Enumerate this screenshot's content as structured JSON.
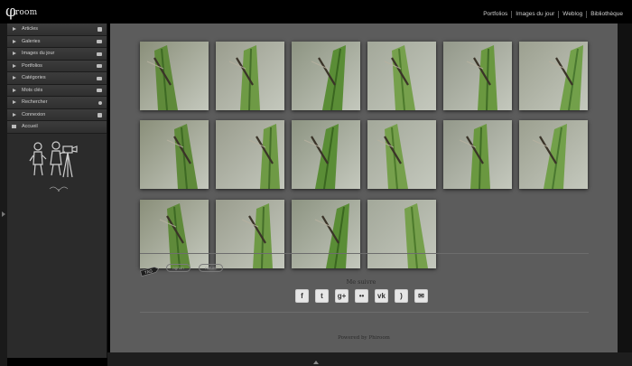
{
  "header": {
    "logo_text": "room",
    "nav": [
      "Portfolios",
      "Images du jour",
      "Weblog",
      "Bibliothèque"
    ]
  },
  "sidebar": {
    "items": [
      {
        "label": "Articles",
        "icon": "document-icon"
      },
      {
        "label": "Galeries",
        "icon": "gallery-icon"
      },
      {
        "label": "Images du jour",
        "icon": "gallery-icon"
      },
      {
        "label": "Portfolios",
        "icon": "gallery-icon"
      },
      {
        "label": "Catégories",
        "icon": "folder-icon"
      },
      {
        "label": "Mots clés",
        "icon": "tags-icon"
      },
      {
        "label": "Rechercher",
        "icon": "search-icon"
      },
      {
        "label": "Connexion",
        "icon": "login-icon"
      },
      {
        "label": "Accueil",
        "icon": "home-icon"
      }
    ]
  },
  "gallery": {
    "thumbnails": [
      {
        "subject": "damselfly on leaf"
      },
      {
        "subject": "damselfly on leaf"
      },
      {
        "subject": "damselfly on leaf"
      },
      {
        "subject": "damselfly on leaf"
      },
      {
        "subject": "damselfly on leaf"
      },
      {
        "subject": "damselfly on leaf"
      },
      {
        "subject": "damselfly on leaf"
      },
      {
        "subject": "damselfly on stem"
      },
      {
        "subject": "damselfly on stem"
      },
      {
        "subject": "dew on leaf"
      },
      {
        "subject": "damselfly on stem"
      },
      {
        "subject": "damselfly on stem"
      },
      {
        "subject": "damselfly on stem"
      },
      {
        "subject": "damselfly on stem"
      },
      {
        "subject": "damselfly on stem"
      },
      {
        "subject": "grass blades"
      }
    ]
  },
  "tags": {
    "icon_label": "TAG",
    "items": [
      "agrion",
      "nature"
    ]
  },
  "social": {
    "title": "Me suivre",
    "networks": [
      {
        "name": "facebook-icon",
        "glyph": "f"
      },
      {
        "name": "twitter-icon",
        "glyph": "t"
      },
      {
        "name": "google-plus-icon",
        "glyph": "g+"
      },
      {
        "name": "flickr-icon",
        "glyph": "••"
      },
      {
        "name": "vk-icon",
        "glyph": "vk"
      },
      {
        "name": "rss-icon",
        "glyph": ")"
      },
      {
        "name": "email-icon",
        "glyph": "✉"
      }
    ]
  },
  "footer": {
    "powered_by": "Powered by Phiroom"
  },
  "colors": {
    "background": "#000000",
    "main_bg": "#5c5c5c",
    "sidebar_bg": "#2b2b2b",
    "text_light": "#d0d0d0"
  }
}
